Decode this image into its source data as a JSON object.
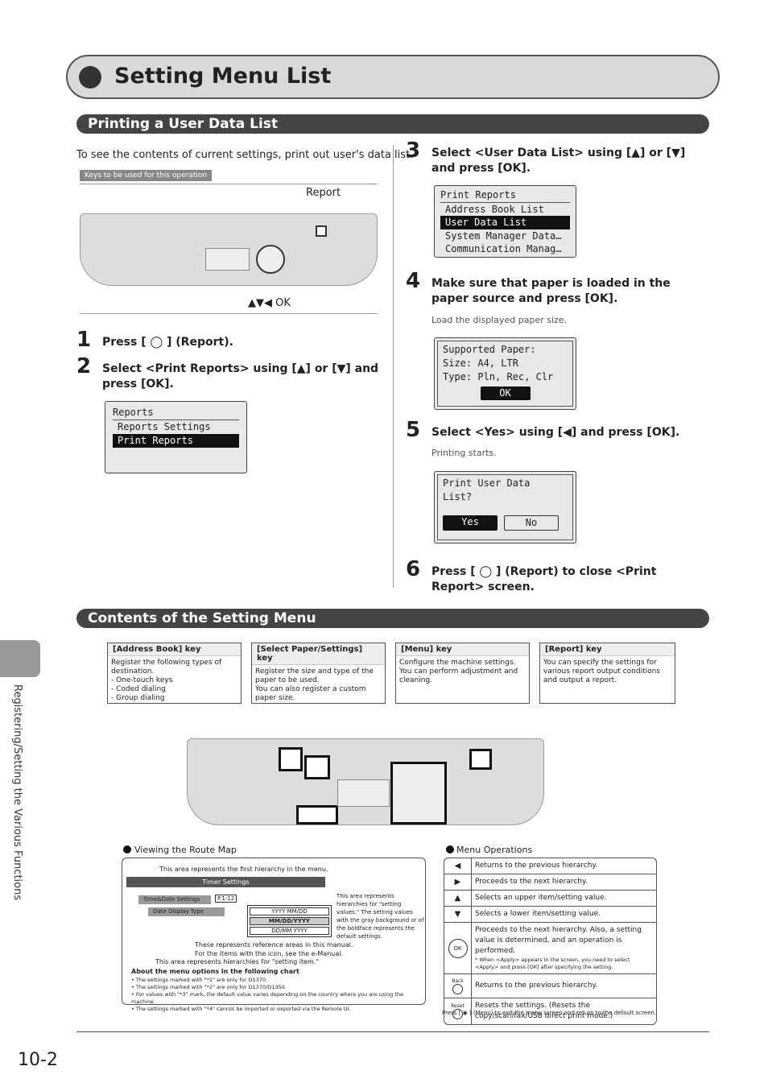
{
  "title": "Setting Menu List",
  "section1": {
    "title": "Printing a User Data List",
    "intro": "To see the contents of current settings, print out user's data list.",
    "keys_label": "Keys to be used for this operation",
    "report_label": "Report",
    "nav_label": "▲▼◀ OK"
  },
  "steps": [
    {
      "num": "1",
      "text": "Press [ ◯ ] (Report)."
    },
    {
      "num": "2",
      "text": "Select <Print Reports> using [▲] or [▼] and press [OK].",
      "lcd": [
        "Reports",
        "Reports Settings",
        "Print Reports"
      ]
    },
    {
      "num": "3",
      "text": "Select <User Data List> using [▲] or [▼] and press [OK].",
      "lcd": [
        "Print Reports",
        "Address Book List",
        "User Data List",
        "System Manager Data…",
        "Communication Manag…"
      ]
    },
    {
      "num": "4",
      "text": "Make sure that paper is loaded in the paper source and press [OK].",
      "note": "Load the displayed paper size.",
      "lcd": [
        "Supported Paper:",
        "Size: A4, LTR",
        "Type: Pln, Rec, Clr"
      ],
      "button": "OK"
    },
    {
      "num": "5",
      "text": "Select <Yes> using [◀] and press [OK].",
      "note": "Printing starts.",
      "lcd": [
        "Print User Data",
        "List?"
      ],
      "yes": "Yes",
      "no": "No"
    },
    {
      "num": "6",
      "text": "Press [ ◯ ] (Report) to close <Print Report> screen."
    }
  ],
  "section2": {
    "title": "Contents of the Setting Menu",
    "keys": [
      {
        "title": "[Address Book] key",
        "body": "Register the following types of destination.\n- One-touch keys\n- Coded dialing\n- Group dialing"
      },
      {
        "title": "[Select Paper/Settings] key",
        "body": "Register the size and type of the paper to be used.\nYou can also register a custom paper size."
      },
      {
        "title": "[Menu] key",
        "body": "Configure the machine settings.\nYou can perform adjustment and cleaning."
      },
      {
        "title": "[Report] key",
        "body": "You can specify the settings for various report output conditions and output a report."
      }
    ],
    "route_map": {
      "title": "Viewing the Route Map",
      "first_hier": "This area represents the first hierarchy in the menu.",
      "timer": "Timer Settings",
      "time_date": "Time&Date Settings",
      "page_ref": "P.1-12",
      "date_display": "Date Display Type",
      "values": [
        "YYYY MM/DD",
        "MM/DD/YYYY",
        "DD/MM YYYY"
      ],
      "values_note": "This area represents hierarchies for \"setting values.\" The setting values with the gray background or of the boldface represents the default settings.",
      "ref_note1": "These represents reference areas in this manual.",
      "ref_note2": "For the items with the icon, see the e-Manual.",
      "item_note": "This area represents hierarchies for \"setting item.\"",
      "about_title": "About the menu options in the following chart",
      "about": [
        "• The settings marked with \"*1\" are only for D1370.",
        "• The settings marked with \"*2\" are only for D1370/D1350.",
        "• For values with \"*3\" mark, the default value varies depending on the country where you are using the machine.",
        "• The settings marked with \"*4\" cannot be imported or exported via the Remote UI."
      ]
    },
    "menu_ops": {
      "title": "Menu Operations",
      "rows": [
        {
          "icon": "◀",
          "text": "Returns to the previous hierarchy."
        },
        {
          "icon": "▶",
          "text": "Proceeds to the next hierarchy."
        },
        {
          "icon": "▲",
          "text": "Selects an upper item/setting value."
        },
        {
          "icon": "▼",
          "text": "Selects a lower item/setting value."
        },
        {
          "icon": "OK",
          "text": "Proceeds to the next hierarchy. Also, a setting value is determined, and an operation is performed.",
          "sub": "* When <Apply> appears in the screen, you need to select <Apply> and press [OK] after specifying the setting."
        },
        {
          "icon": "Back",
          "text": "Returns to the previous hierarchy."
        },
        {
          "icon": "Reset",
          "text": "Resets the settings. (Resets the copy/scan/fax/USB direct print mode.)"
        }
      ],
      "footer": "Press [ ◉ ] (Menu) to exit the menu screen and return to the default screen."
    }
  },
  "side_tab": "Registering/Setting the Various Functions",
  "page_number": "10-2"
}
